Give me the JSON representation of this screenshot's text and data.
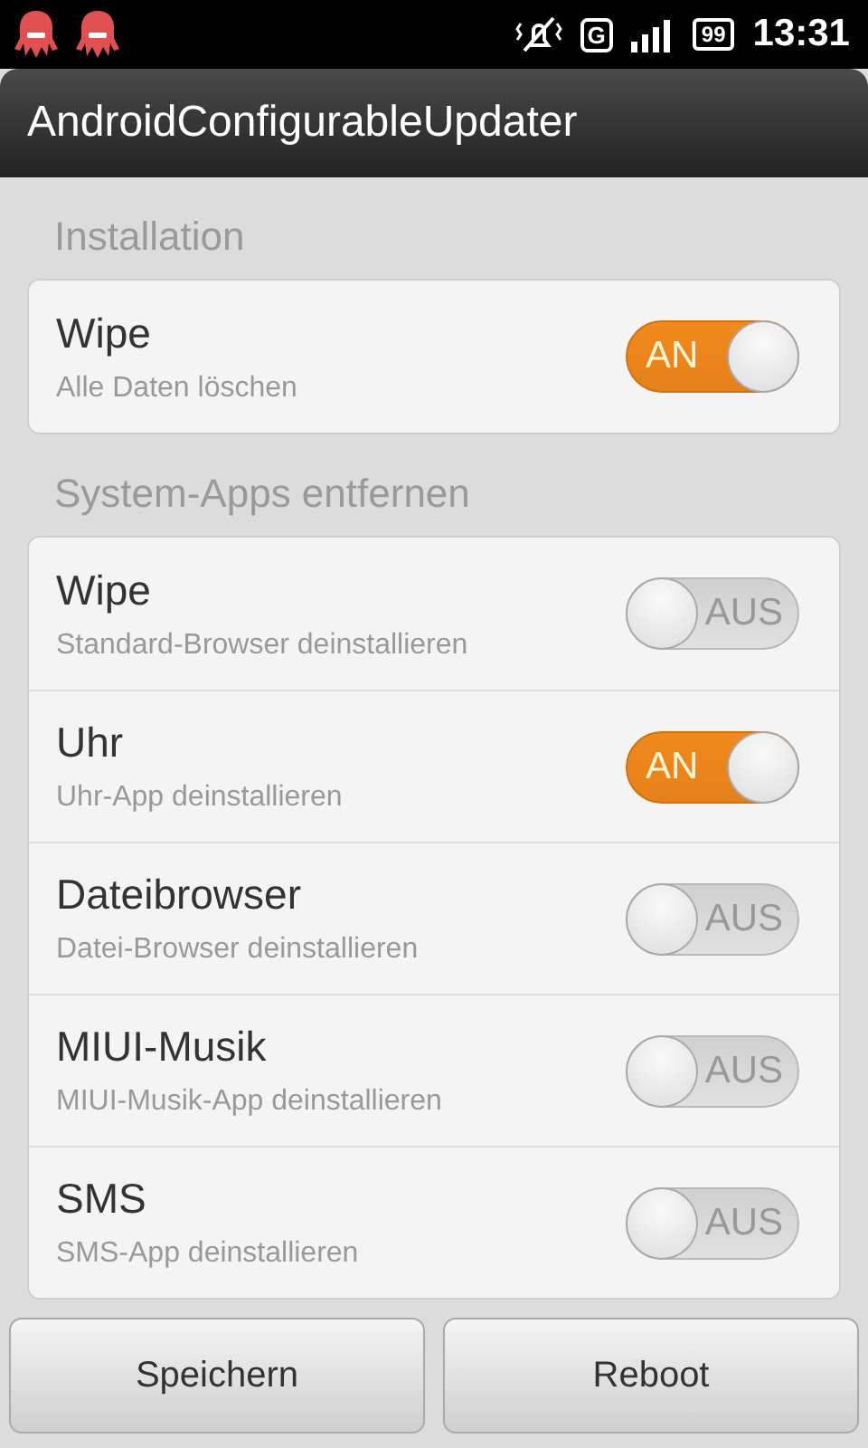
{
  "status_bar": {
    "notifications": [
      {
        "kind": "octopus"
      },
      {
        "kind": "octopus"
      }
    ],
    "network_type": "G",
    "battery": "99",
    "time": "13:31"
  },
  "window": {
    "title": "AndroidConfigurableUpdater"
  },
  "sections": [
    {
      "title": "Installation",
      "items": [
        {
          "title": "Wipe",
          "summary": "Alle Daten löschen",
          "on": true,
          "switch_label": "AN"
        }
      ]
    },
    {
      "title": "System-Apps entfernen",
      "items": [
        {
          "title": "Wipe",
          "summary": "Standard-Browser deinstallieren",
          "on": false,
          "switch_label": "AUS"
        },
        {
          "title": "Uhr",
          "summary": "Uhr-App deinstallieren",
          "on": true,
          "switch_label": "AN"
        },
        {
          "title": "Dateibrowser",
          "summary": "Datei-Browser deinstallieren",
          "on": false,
          "switch_label": "AUS"
        },
        {
          "title": "MIUI-Musik",
          "summary": "MIUI-Musik-App deinstallieren",
          "on": false,
          "switch_label": "AUS"
        },
        {
          "title": "SMS",
          "summary": "SMS-App deinstallieren",
          "on": false,
          "switch_label": "AUS"
        }
      ]
    }
  ],
  "buttons": [
    "Speichern",
    "Reboot"
  ]
}
